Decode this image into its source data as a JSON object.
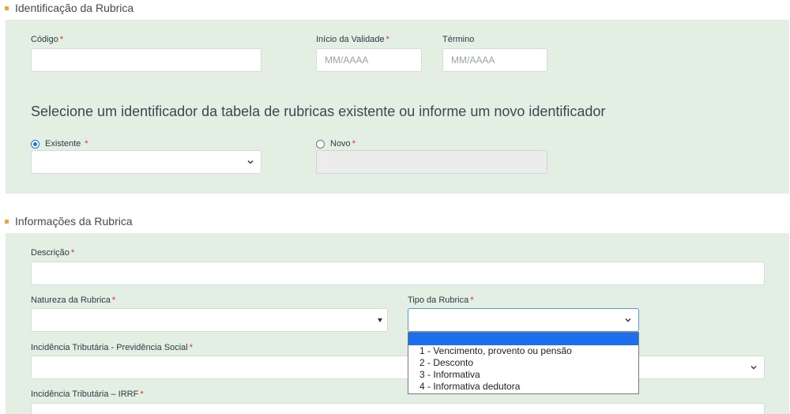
{
  "section1": {
    "title": "Identificação da Rubrica",
    "codigo_label": "Código",
    "codigo_value": "",
    "inicio_label": "Início da Validade",
    "inicio_placeholder": "MM/AAAA",
    "termino_label": "Término",
    "termino_placeholder": "MM/AAAA",
    "instruction": "Selecione um identificador da tabela de rubricas existente ou informe um novo identificador",
    "existente_label": "Existente",
    "existente_selected": true,
    "novo_label": "Novo",
    "novo_selected": false
  },
  "section2": {
    "title": "Informações da Rubrica",
    "descricao_label": "Descrição",
    "natureza_label": "Natureza da Rubrica",
    "tipo_label": "Tipo da Rubrica",
    "incidencia_prev_label": "Incidência Tributária - Previdência Social",
    "incidencia_irrf_label": "Incidência Tributária – IRRF",
    "tipo_options": [
      "",
      "1 - Vencimento, provento ou pensão",
      "2 - Desconto",
      "3 - Informativa",
      "4 - Informativa dedutora"
    ]
  },
  "required_marker": "*",
  "colors": {
    "panel_bg": "#e3efe3",
    "accent_bullet": "#f0a43b",
    "required": "#d62c2c",
    "option_highlight": "#1e6ff0",
    "radio_on": "#1a73e8"
  },
  "icons": [
    "chevron-down-icon",
    "triangle-down-icon"
  ]
}
